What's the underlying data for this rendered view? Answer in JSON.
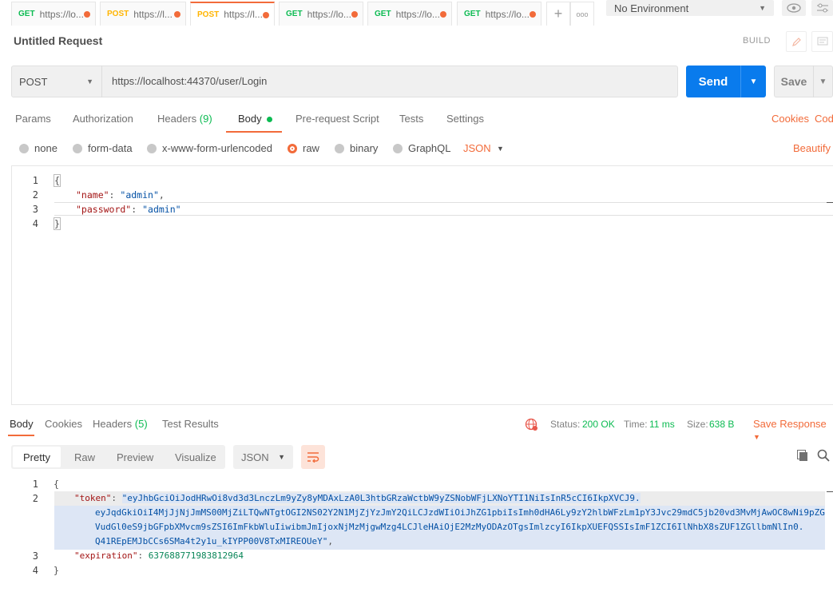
{
  "tabs": [
    {
      "method": "GET",
      "url": "https://lo..."
    },
    {
      "method": "POST",
      "url": "https://l..."
    },
    {
      "method": "POST",
      "url": "https://l..."
    },
    {
      "method": "GET",
      "url": "https://lo..."
    },
    {
      "method": "GET",
      "url": "https://lo..."
    },
    {
      "method": "GET",
      "url": "https://lo..."
    }
  ],
  "tab_controls": {
    "add": "+",
    "more": "ooo"
  },
  "environment": "No Environment",
  "request": {
    "title": "Untitled Request",
    "build": "BUILD",
    "method": "POST",
    "url": "https://localhost:44370/user/Login",
    "send": "Send",
    "save": "Save"
  },
  "request_tabs": {
    "params": "Params",
    "authorization": "Authorization",
    "headers": "Headers",
    "headers_count": "(9)",
    "body": "Body",
    "prerequest": "Pre-request Script",
    "tests": "Tests",
    "settings": "Settings",
    "cookies": "Cookies",
    "code": "Cod"
  },
  "body_types": {
    "none": "none",
    "form_data": "form-data",
    "urlencoded": "x-www-form-urlencoded",
    "raw": "raw",
    "binary": "binary",
    "graphql": "GraphQL",
    "format": "JSON",
    "beautify": "Beautify"
  },
  "request_body": {
    "line_numbers": [
      "1",
      "2",
      "3",
      "4"
    ],
    "open": "{",
    "name_key": "\"name\"",
    "name_val": "\"admin\"",
    "password_key": "\"password\"",
    "password_val": "\"admin\"",
    "close": "}"
  },
  "response_tabs": {
    "body": "Body",
    "cookies": "Cookies",
    "headers": "Headers",
    "headers_count": "(5)",
    "test_results": "Test Results"
  },
  "response_status": {
    "status_label": "Status:",
    "status": "200 OK",
    "time_label": "Time:",
    "time": "11 ms",
    "size_label": "Size:",
    "size": "638 B",
    "save_response": "Save Response"
  },
  "view_modes": {
    "pretty": "Pretty",
    "raw": "Raw",
    "preview": "Preview",
    "visualize": "Visualize",
    "format": "JSON"
  },
  "response_body": {
    "line_numbers": [
      "1",
      "2",
      "",
      "",
      "",
      "3",
      "4"
    ],
    "open": "{",
    "token_key": "\"token\"",
    "token_line1": "\"eyJhbGciOiJodHRwOi8vd3d3LnczLm9yZy8yMDAxLzA0L3htbGRzaWctbW9yZSNobWFjLXNoYTI1NiIsInR5cCI6IkpXVCJ9.",
    "token_line2": "eyJqdGkiOiI4MjJjNjJmMS00MjZiLTQwNTgtOGI2NS02Y2N1MjZjYzJmY2QiLCJzdWIiOiJhZG1pbiIsImh0dHA6Ly9zY2hlbWFzLm1pY3Jvc29mdC5jb20vd3MvMjAwOC8wNi9pZG",
    "token_line3": "VudGl0eS9jbGFpbXMvcm9sZSI6ImFkbWluIiwibmJmIjoxNjMzMjgwMzg4LCJleHAiOjE2MzMyODAzOTgsImlzcyI6IkpXUEFQSSIsImF1ZCI6IlNhbX8sZUF1ZGllbmNlIn0.",
    "token_line4": "Q41REpEMJbCCs6SMa4t2y1u_kIYPP00V8TxMIREOUeY\"",
    "expiration_key": "\"expiration\"",
    "expiration_val": "637688771983812964",
    "close": "}"
  },
  "colors": {
    "accent": "#f26b3a",
    "send": "#097bed",
    "success": "#0cbb52"
  }
}
